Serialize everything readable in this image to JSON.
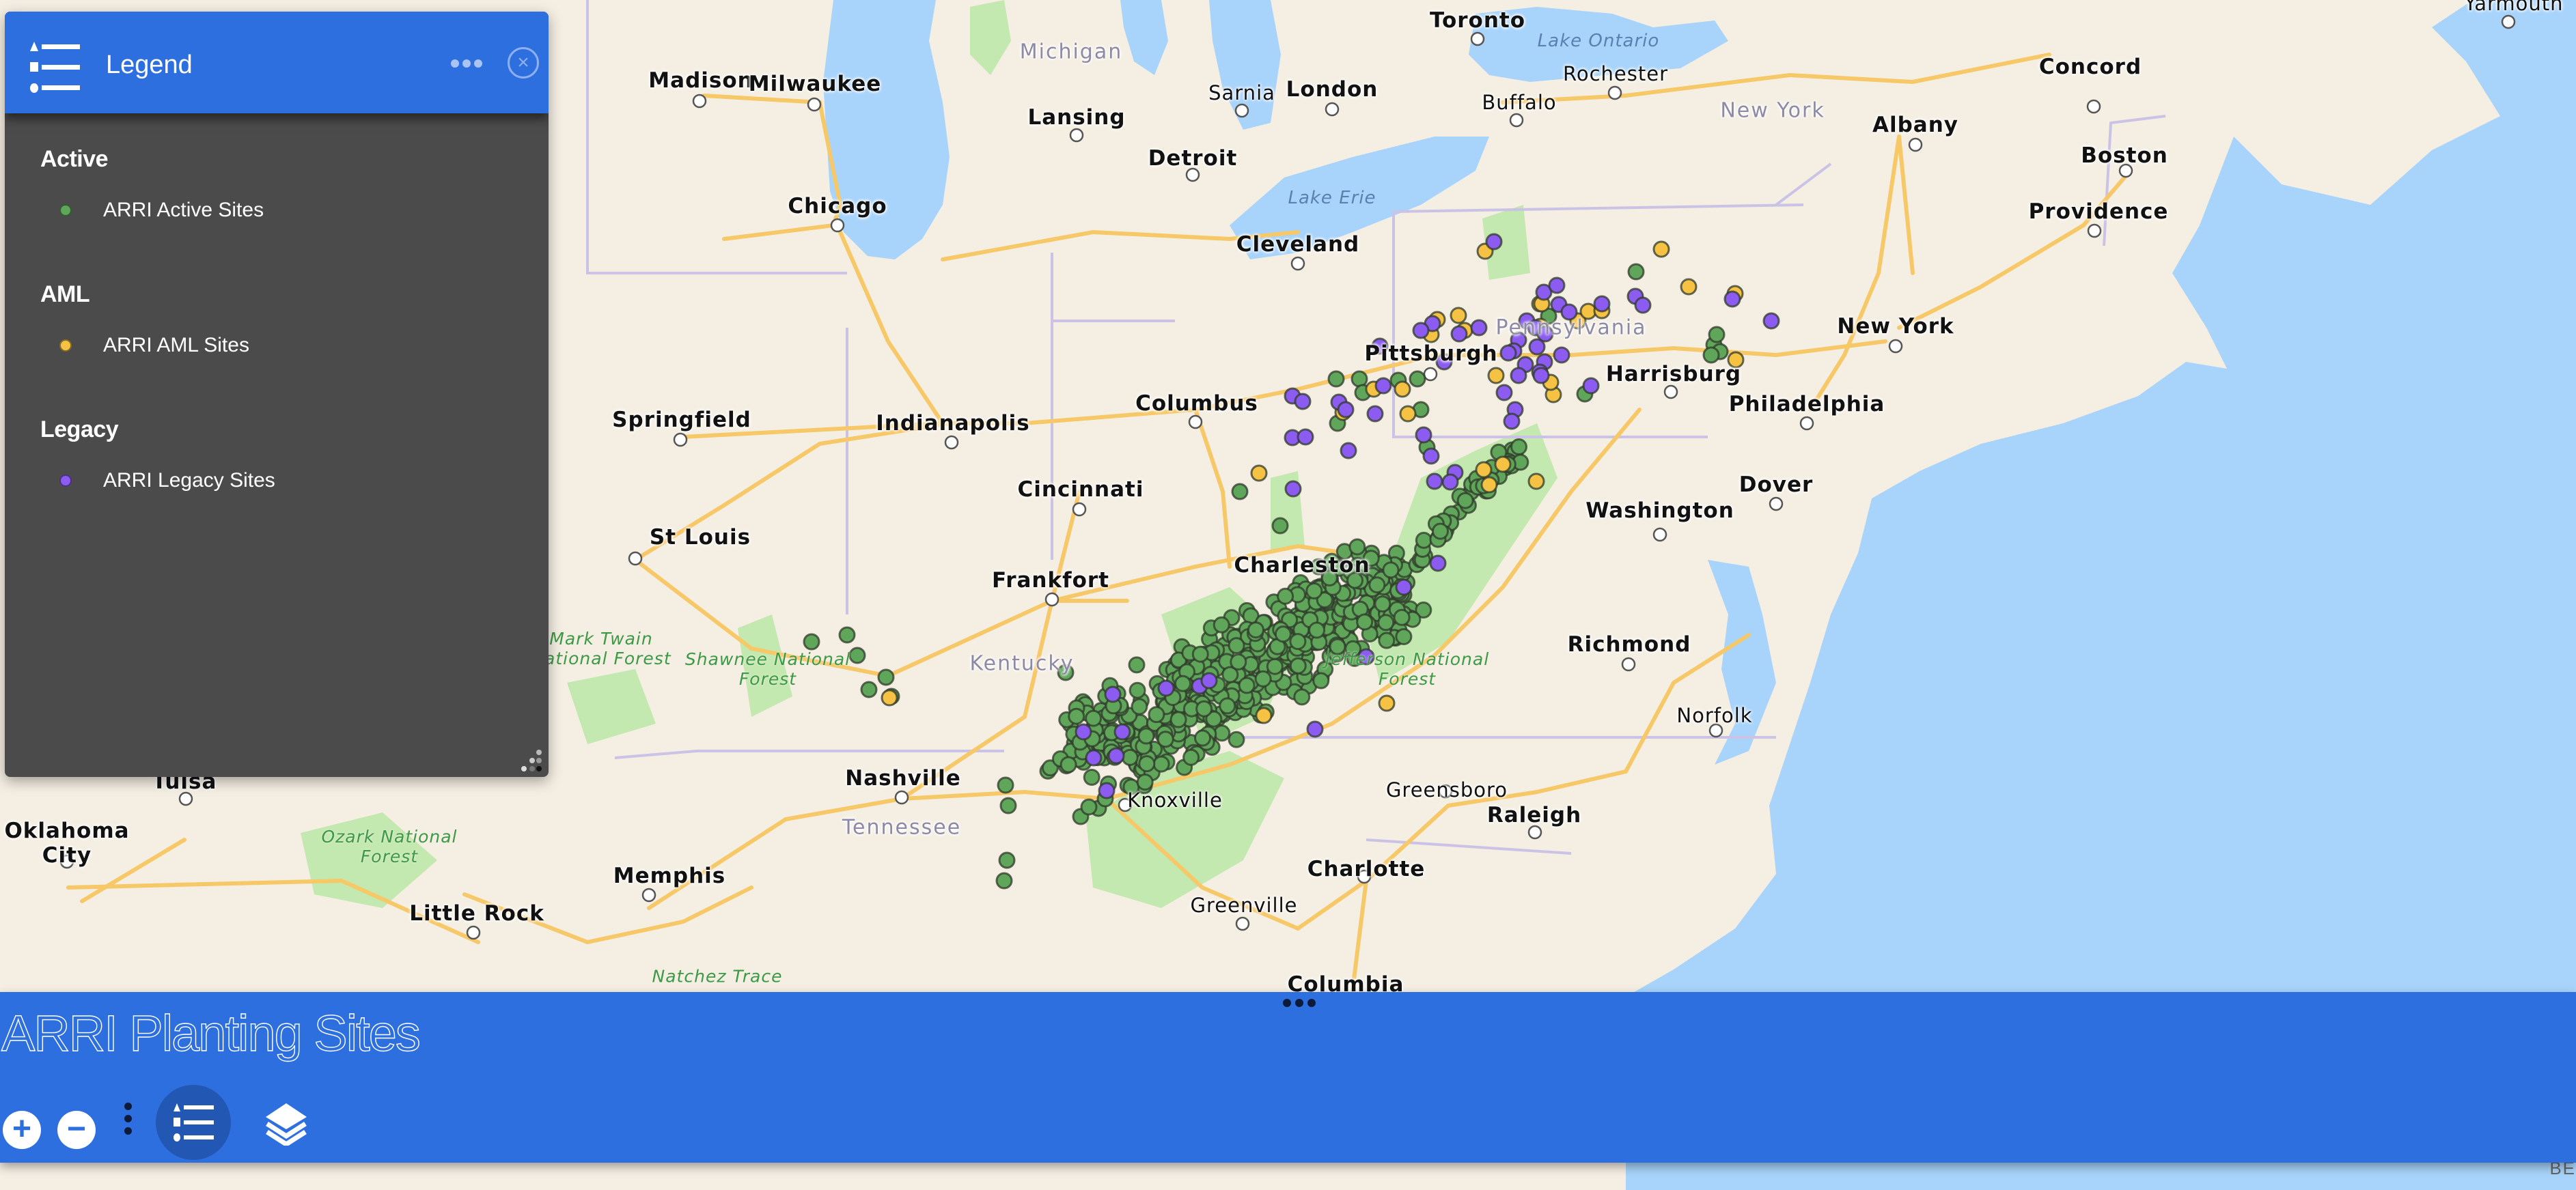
{
  "app": {
    "title": "ARRI Planting Sites"
  },
  "legend_widget": {
    "title": "Legend",
    "icon": "legend-list-icon",
    "more_icon": "ellipsis-icon",
    "close_icon": "close-circle-icon",
    "close_glyph": "×",
    "groups": [
      {
        "title": "Active",
        "items": [
          {
            "label": "ARRI Active Sites",
            "color": "#5fa55a"
          }
        ]
      },
      {
        "title": "AML",
        "items": [
          {
            "label": "ARRI AML Sites",
            "color": "#f6c244"
          }
        ]
      },
      {
        "title": "Legacy",
        "items": [
          {
            "label": "ARRI Legacy Sites",
            "color": "#8c5cf0"
          }
        ]
      }
    ]
  },
  "toolbar": {
    "zoom_in_glyph": "+",
    "zoom_out_glyph": "−",
    "zoom_in_icon": "plus-icon",
    "zoom_out_icon": "minus-icon",
    "more_icon": "vertical-ellipsis-icon",
    "legend_button_icon": "legend-list-icon",
    "layers_button_icon": "layers-icon"
  },
  "colors": {
    "accent": "#2e6fe0",
    "accent_active": "#2257b3",
    "panel_bg": "#4b4b4b",
    "land": "#f5efe3",
    "water": "#a8d4fb",
    "forest": "#c3e8b0",
    "road": "#f7c868",
    "border": "#cbc3e6",
    "active_site": "#5fa55a",
    "aml_site": "#f6c244",
    "legacy_site": "#8c5cf0"
  },
  "map": {
    "attribution_fragment": "BE",
    "labels": [
      {
        "text": "Toronto",
        "kind": "major"
      },
      {
        "text": "Lake Ontario",
        "kind": "water"
      },
      {
        "text": "Rochester",
        "kind": "minor"
      },
      {
        "text": "Buffalo",
        "kind": "minor"
      },
      {
        "text": "New York",
        "kind": "state"
      },
      {
        "text": "Albany",
        "kind": "major"
      },
      {
        "text": "Concord",
        "kind": "major"
      },
      {
        "text": "Boston",
        "kind": "major"
      },
      {
        "text": "Providence",
        "kind": "major"
      },
      {
        "text": "Yarmouth",
        "kind": "minor"
      },
      {
        "text": "Michigan",
        "kind": "state"
      },
      {
        "text": "Madison",
        "kind": "major"
      },
      {
        "text": "Milwaukee",
        "kind": "major"
      },
      {
        "text": "Sarnia",
        "kind": "minor"
      },
      {
        "text": "London",
        "kind": "major"
      },
      {
        "text": "Lansing",
        "kind": "major"
      },
      {
        "text": "Detroit",
        "kind": "major"
      },
      {
        "text": "Lake Erie",
        "kind": "water"
      },
      {
        "text": "Chicago",
        "kind": "major"
      },
      {
        "text": "Cleveland",
        "kind": "major"
      },
      {
        "text": "Pittsburgh",
        "kind": "major"
      },
      {
        "text": "Pennsylvania",
        "kind": "state"
      },
      {
        "text": "Harrisburg",
        "kind": "major"
      },
      {
        "text": "New York",
        "kind": "major"
      },
      {
        "text": "Philadelphia",
        "kind": "major"
      },
      {
        "text": "Columbus",
        "kind": "major"
      },
      {
        "text": "Springfield",
        "kind": "major"
      },
      {
        "text": "Indianapolis",
        "kind": "major"
      },
      {
        "text": "Cincinnati",
        "kind": "major"
      },
      {
        "text": "Dover",
        "kind": "major"
      },
      {
        "text": "Washington",
        "kind": "major"
      },
      {
        "text": "St Louis",
        "kind": "major"
      },
      {
        "text": "Frankfort",
        "kind": "major"
      },
      {
        "text": "Charleston",
        "kind": "major"
      },
      {
        "text": "Richmond",
        "kind": "major"
      },
      {
        "text": "Kentucky",
        "kind": "state"
      },
      {
        "text": "Shawnee National Forest",
        "kind": "forest"
      },
      {
        "text": "Mark Twain National Forest",
        "kind": "forest"
      },
      {
        "text": "Jefferson National Forest",
        "kind": "forest"
      },
      {
        "text": "Norfolk",
        "kind": "minor"
      },
      {
        "text": "Nashville",
        "kind": "major"
      },
      {
        "text": "Knoxville",
        "kind": "minor"
      },
      {
        "text": "Greensboro",
        "kind": "minor"
      },
      {
        "text": "Raleigh",
        "kind": "major"
      },
      {
        "text": "Tulsa",
        "kind": "major"
      },
      {
        "text": "Oklahoma City",
        "kind": "major"
      },
      {
        "text": "Tennessee",
        "kind": "state"
      },
      {
        "text": "Ozark National Forest",
        "kind": "forest"
      },
      {
        "text": "Memphis",
        "kind": "major"
      },
      {
        "text": "Charlotte",
        "kind": "major"
      },
      {
        "text": "Little Rock",
        "kind": "major"
      },
      {
        "text": "Greenville",
        "kind": "minor"
      },
      {
        "text": "Columbia",
        "kind": "major"
      },
      {
        "text": "Natchez Trace",
        "kind": "forest"
      }
    ],
    "layers": [
      {
        "name": "ARRI Active Sites",
        "category": "Active",
        "color": "#5fa55a"
      },
      {
        "name": "ARRI AML Sites",
        "category": "AML",
        "color": "#f6c244"
      },
      {
        "name": "ARRI Legacy Sites",
        "category": "Legacy",
        "color": "#8c5cf0"
      }
    ]
  }
}
